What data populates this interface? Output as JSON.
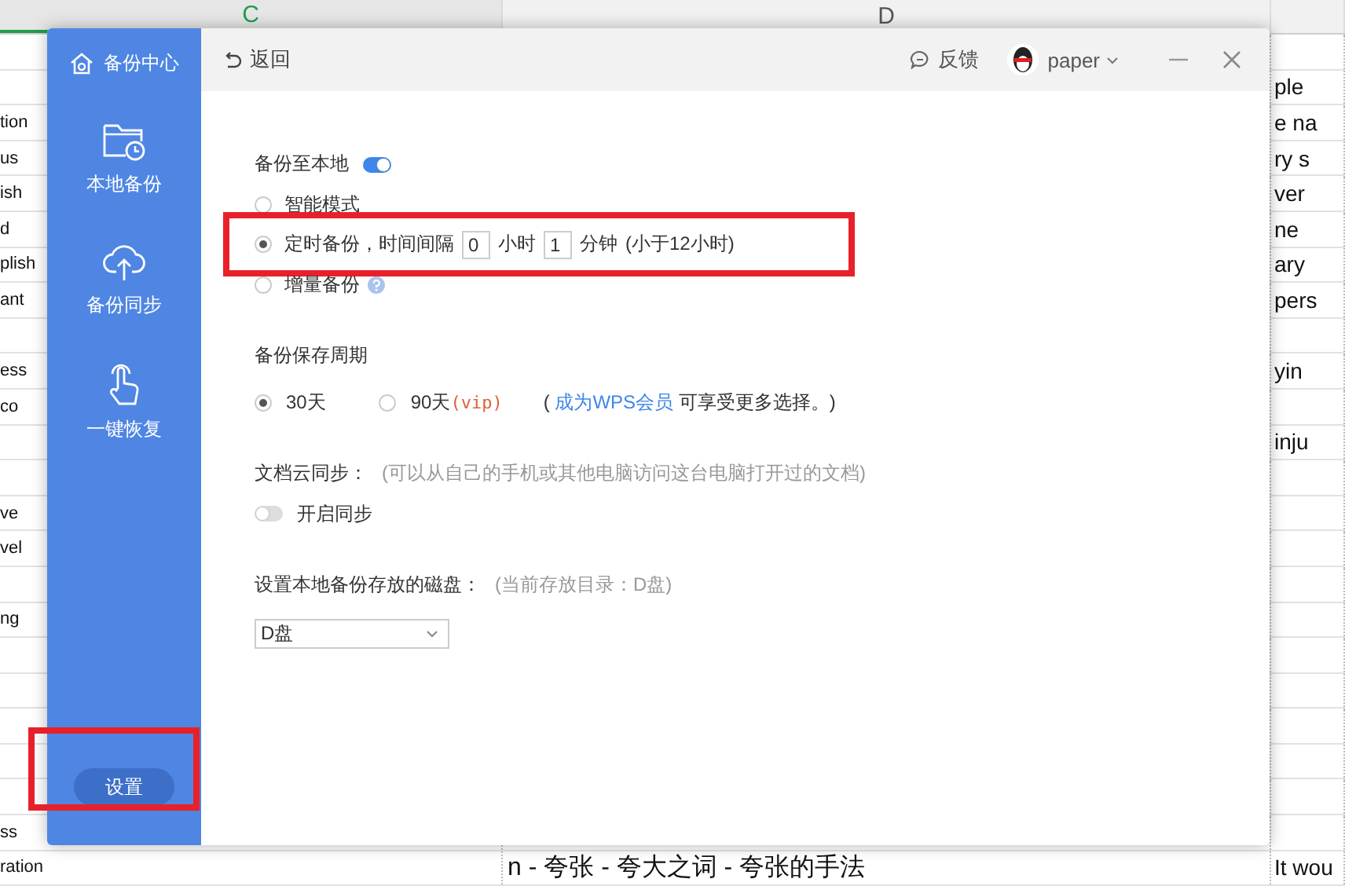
{
  "spreadsheet": {
    "column_headers": [
      {
        "label": "C",
        "selected": true
      },
      {
        "label": "D",
        "selected": false
      }
    ],
    "rows": [
      {},
      {
        "column_3": "ple"
      },
      {
        "column_1": "tion",
        "column_3": "e na"
      },
      {
        "column_1": "us",
        "column_3": "ry s"
      },
      {
        "column_1": "ish",
        "column_3": "ver"
      },
      {
        "column_1": "d",
        "column_3": "ne"
      },
      {
        "column_1": "plish",
        "column_3": "ary"
      },
      {
        "column_1": "ant",
        "column_3": "pers"
      },
      {},
      {
        "column_1": "ess",
        "column_3": "yin"
      },
      {
        "column_1": "co"
      },
      {
        "column_3": "inju"
      },
      {},
      {
        "column_1": "ve"
      },
      {
        "column_1": "vel"
      },
      {},
      {
        "column_1": "ng"
      },
      {},
      {},
      {},
      {},
      {},
      {
        "column_1": "ss"
      },
      {
        "column_1": "ration",
        "column_2": "n - 夸张 - 夸大之词 - 夸张的手法",
        "column_3": "It wou"
      }
    ]
  },
  "dialog": {
    "sidebar": {
      "title": "备份中心",
      "items": [
        "本地备份",
        "备份同步",
        "一键恢复"
      ],
      "settings_button": "设置"
    },
    "header": {
      "back": "返回",
      "feedback": "反馈",
      "user": "paper"
    },
    "local_backup": {
      "label": "备份至本地",
      "on": true,
      "modes": [
        {
          "kind": "plain",
          "label": "智能模式",
          "selected": false
        },
        {
          "kind": "interval",
          "label": "定时备份，时间间隔",
          "selected": true,
          "hours": "0",
          "hours_unit": "小时",
          "minutes": "1",
          "minutes_unit": "分钟",
          "note": "(小于12小时)"
        },
        {
          "kind": "help",
          "label": "增量备份",
          "selected": false
        }
      ]
    },
    "retention": {
      "label": "备份保存周期",
      "options": [
        {
          "label": "30天",
          "selected": true
        },
        {
          "label": "90天",
          "suffix": "(vip)",
          "selected": false
        }
      ],
      "note_start": "(",
      "note_link": "成为WPS会员",
      "note_end": "可享受更多选择。)"
    },
    "cloud_sync": {
      "label": "文档云同步：",
      "hint": "(可以从自己的手机或其他电脑访问这台电脑打开过的文档)",
      "toggle_label": "开启同步",
      "on": false
    },
    "disk": {
      "label": "设置本地备份存放的磁盘：",
      "hint": "(当前存放目录：D盘)",
      "value": "D盘"
    }
  }
}
